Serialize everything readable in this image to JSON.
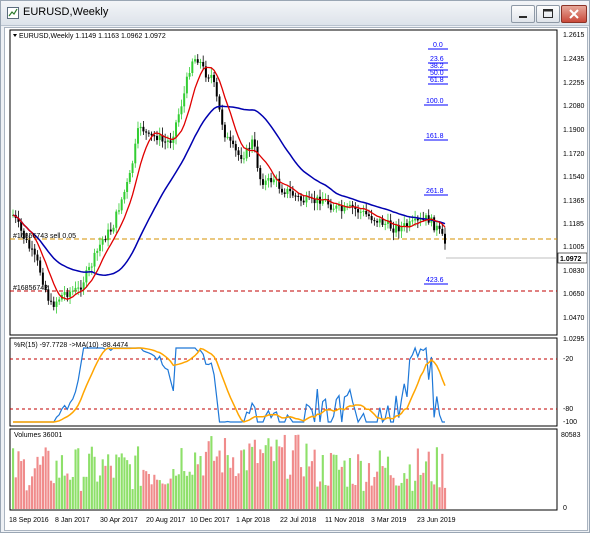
{
  "window": {
    "title": "EURUSD,Weekly"
  },
  "main_pane": {
    "label": "EURUSD,Weekly  1.1149 1.1163 1.0962 1.0972",
    "current_price_label": "1.0972",
    "line_labels": [
      "#16856743 sell 0.05",
      "#16856742"
    ],
    "fibo_levels": [
      "0.0",
      "23.6",
      "38.2",
      "50.0",
      "61.8",
      "100.0",
      "161.8",
      "261.8",
      "423.6"
    ],
    "price_axis": [
      "1.2615",
      "1.2435",
      "1.2255",
      "1.2080",
      "1.1900",
      "1.1720",
      "1.1540",
      "1.1365",
      "1.1185",
      "1.1005",
      "1.0830",
      "1.0650",
      "1.0470",
      "1.0295"
    ]
  },
  "wpr_pane": {
    "label": "%R(15) -97.7728  ->MA(10) -88.4474",
    "levels": [
      "-20",
      "-80",
      "-100"
    ]
  },
  "volume_pane": {
    "label": "Volumes 36001",
    "max_label": "80583",
    "zero_label": "0"
  },
  "time_axis": [
    "18 Sep 2016",
    "8 Jan 2017",
    "30 Apr 2017",
    "20 Aug 2017",
    "10 Dec 2017",
    "1 Apr 2018",
    "22 Jul 2018",
    "11 Nov 2018",
    "3 Mar 2019",
    "23 Jun 2019"
  ],
  "colors": {
    "bull_candle": "#32cd32",
    "bear_candle": "#000000",
    "ma_fast": "#e00000",
    "ma_slow": "#0000b0",
    "wpr_line": "#1e78d8",
    "wpr_ma": "#ffa500",
    "fibo": "#0000ff",
    "vol_up": "#8ee06a",
    "vol_down": "#f08b8b",
    "level_red": "#c00000",
    "level_orange": "#d59000"
  }
}
